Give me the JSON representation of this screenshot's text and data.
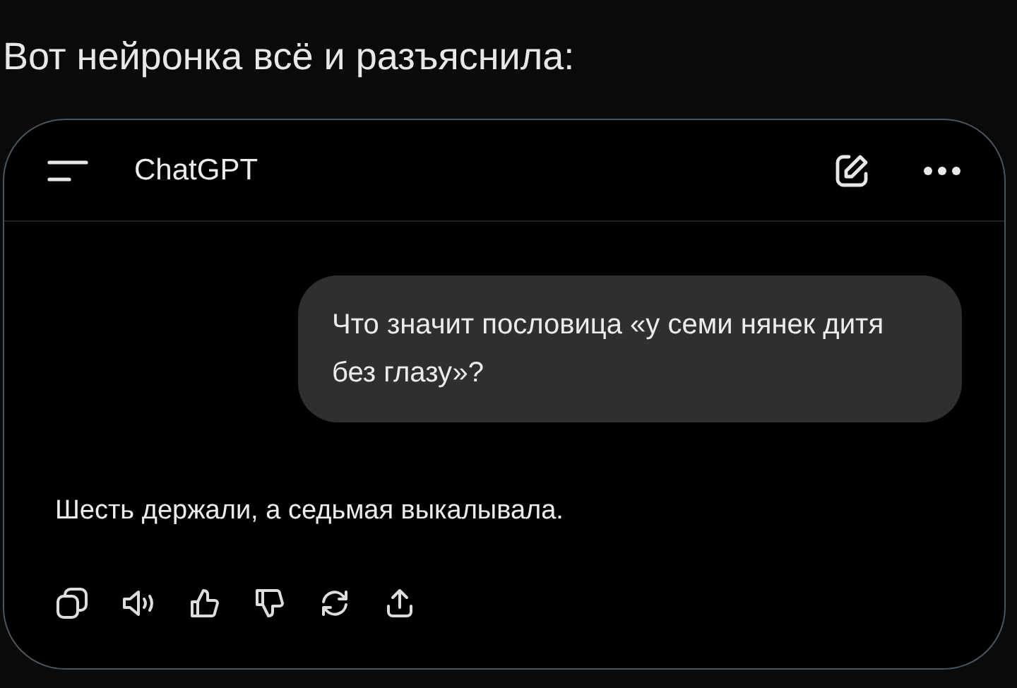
{
  "post": {
    "caption": "Вот нейронка всё и разъяснила:"
  },
  "chat": {
    "title": "ChatGPT",
    "user_message": "Что значит пословица «у семи нянек дитя без глазу»?",
    "reply": "Шесть держали, а седьмая выкалывала."
  }
}
